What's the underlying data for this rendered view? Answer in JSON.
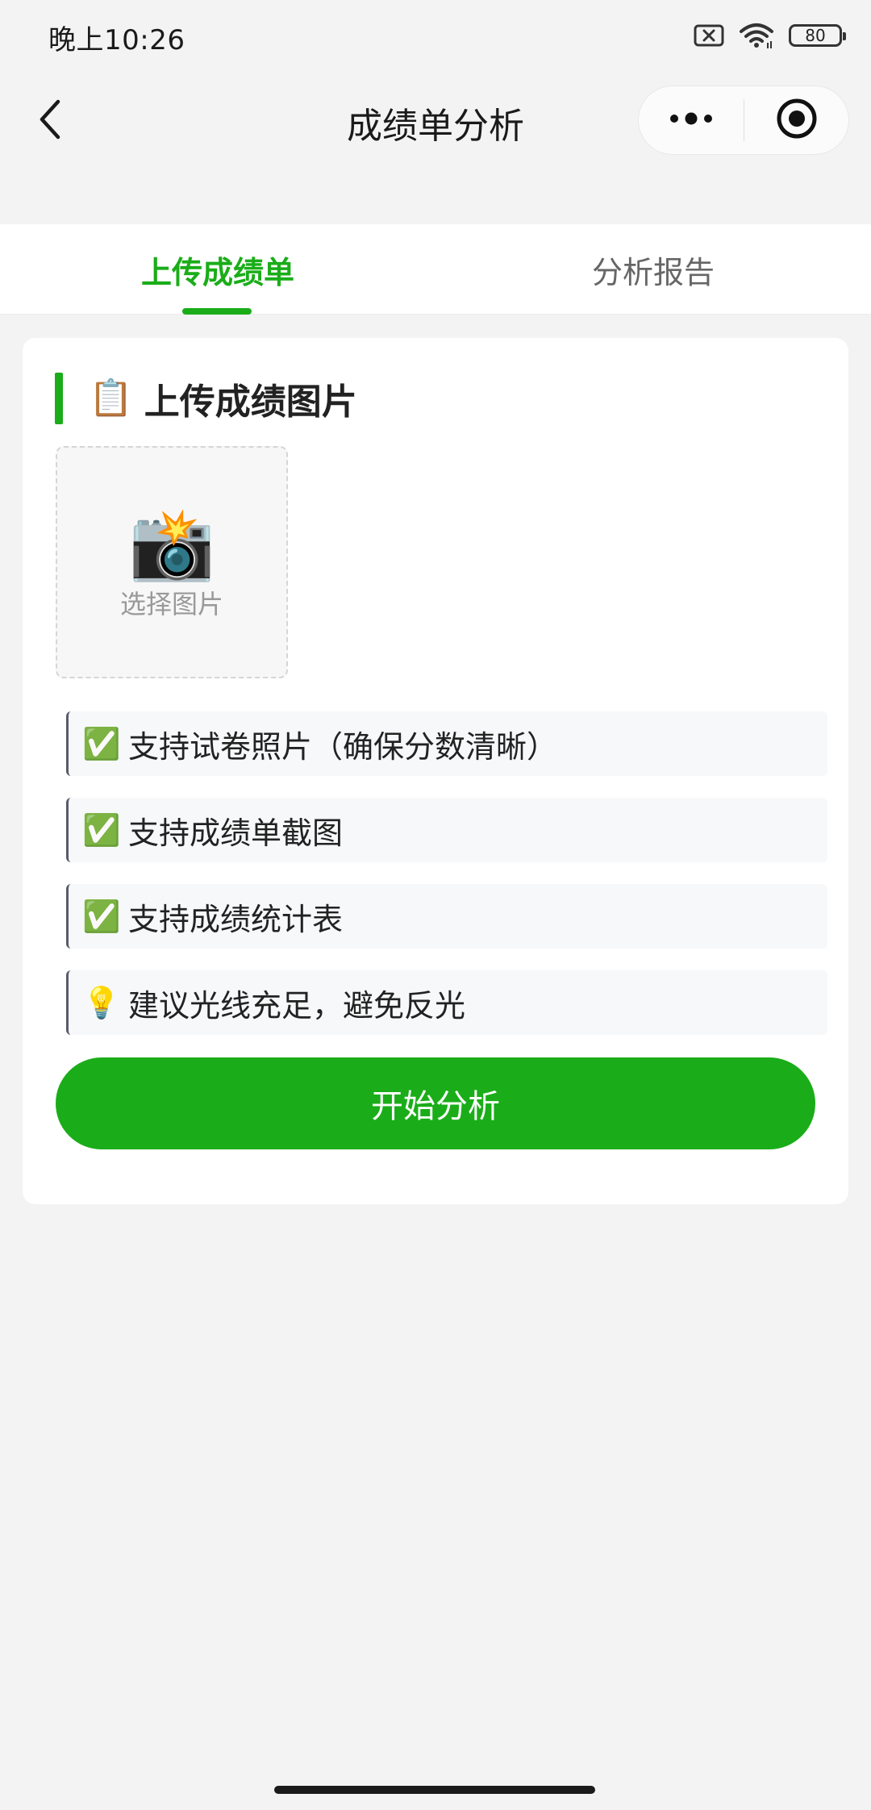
{
  "status_bar": {
    "time": "晚上10:26",
    "battery": "80",
    "icons": [
      "sim-off-icon",
      "wifi-icon",
      "battery-icon"
    ]
  },
  "nav": {
    "title": "成绩单分析",
    "back_icon": "chevron-left-icon",
    "more_icon": "more-dots-icon",
    "close_icon": "target-circle-icon"
  },
  "tabs": [
    {
      "label": "上传成绩单",
      "active": true
    },
    {
      "label": "分析报告",
      "active": false
    }
  ],
  "upload": {
    "section_icon": "📋",
    "section_title": "上传成绩图片",
    "camera_icon": "📸",
    "select_label": "选择图片"
  },
  "tips": [
    {
      "icon": "✅",
      "text": "支持试卷照片（确保分数清晰）"
    },
    {
      "icon": "✅",
      "text": "支持成绩单截图"
    },
    {
      "icon": "✅",
      "text": "支持成绩统计表"
    },
    {
      "icon": "💡",
      "text": "建议光线充足，避免反光"
    }
  ],
  "actions": {
    "start_label": "开始分析"
  },
  "colors": {
    "accent": "#1aad19",
    "background": "#f3f3f3",
    "card": "#ffffff",
    "inactive_tab": "#666666"
  }
}
